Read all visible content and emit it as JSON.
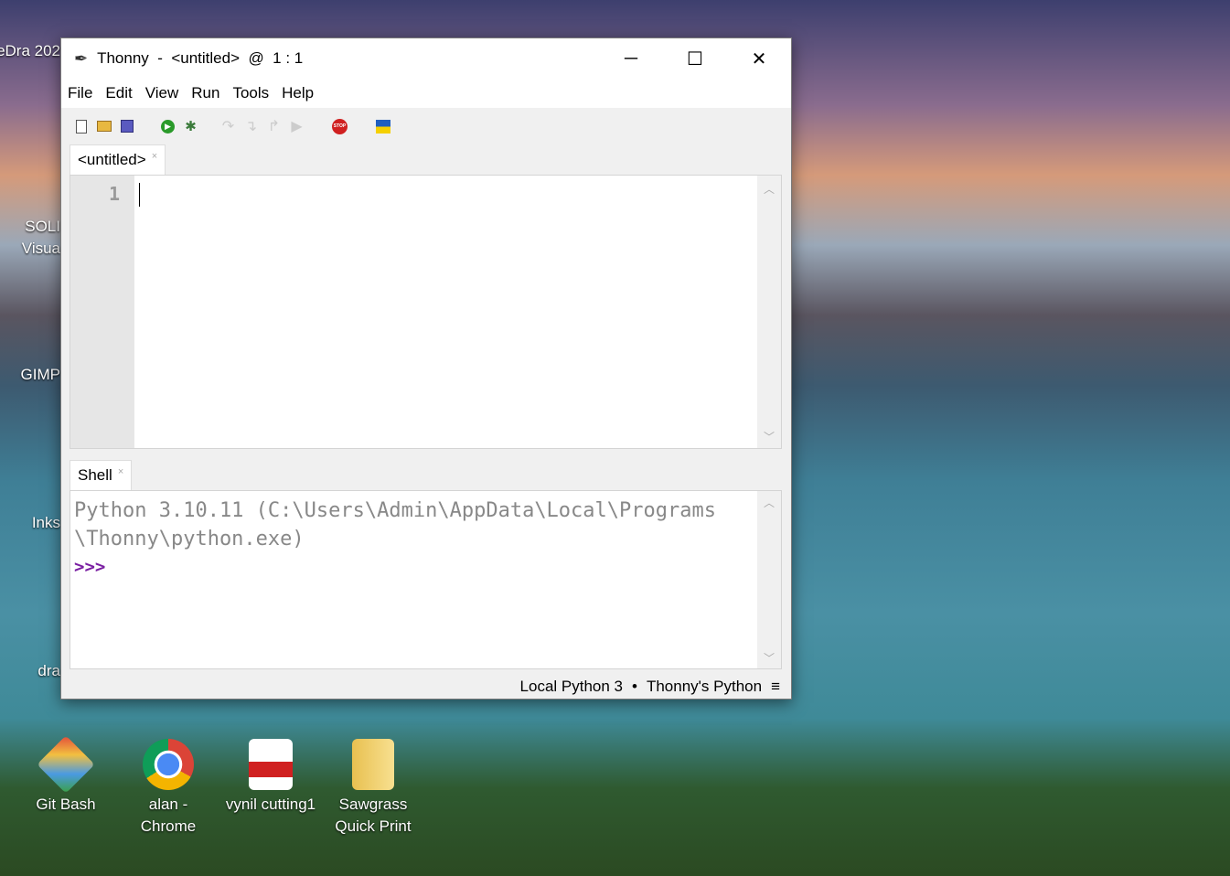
{
  "desktop": {
    "left_icons": [
      {
        "label": "eDra 202"
      },
      {
        "label": "SOLI Visua"
      },
      {
        "label": "GIMP"
      },
      {
        "label": "Inks"
      },
      {
        "label": "dra"
      }
    ],
    "bottom_icons": [
      {
        "label": "Git Bash"
      },
      {
        "label": "alan - Chrome"
      },
      {
        "label": "vynil cutting1"
      },
      {
        "label": "Sawgrass Quick Print"
      }
    ]
  },
  "window": {
    "title": "Thonny  -  <untitled>  @  1 : 1",
    "menu": [
      "File",
      "Edit",
      "View",
      "Run",
      "Tools",
      "Help"
    ],
    "toolbar": [
      "new-file",
      "open-file",
      "save-file",
      "run",
      "debug",
      "step-over",
      "step-into",
      "step-out",
      "resume",
      "stop",
      "ukraine-flag"
    ],
    "editor": {
      "tab": "<untitled>",
      "line_number": "1",
      "content": ""
    },
    "shell": {
      "tab": "Shell",
      "banner_line1": "Python 3.10.11 (C:\\Users\\Admin\\AppData\\Local\\Programs",
      "banner_line2": "\\Thonny\\python.exe)",
      "prompt": ">>>"
    },
    "status": {
      "interpreter": "Local Python 3",
      "separator": "•",
      "python": "Thonny's Python",
      "menu_glyph": "≡"
    },
    "colors": {
      "prompt": "#7a1fa2",
      "banner": "#888888",
      "stop": "#d02020",
      "run": "#2a9a2a"
    }
  }
}
